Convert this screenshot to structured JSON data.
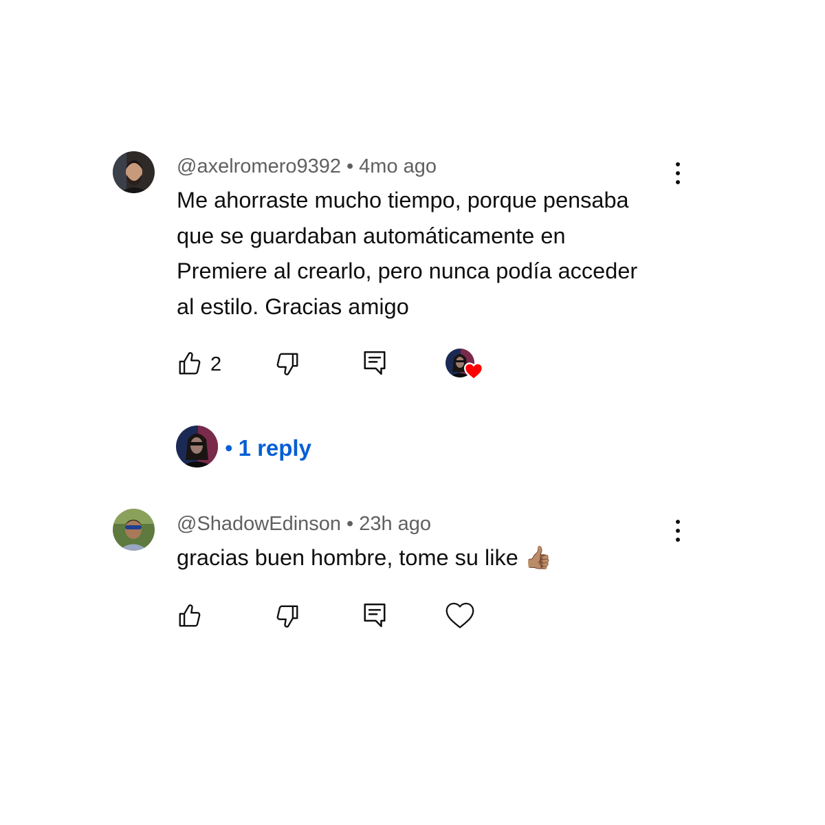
{
  "comments": [
    {
      "handle": "@axelromero9392",
      "separator": "•",
      "age": "4mo ago",
      "lines": [
        "Me ahorraste mucho tiempo, porque pensaba",
        "que se guardaban automáticamente en",
        "Premiere al crearlo, pero nunca podía acceder",
        "al estilo. Gracias amigo"
      ],
      "like_count": "2",
      "hearted": true,
      "replies": {
        "separator": "•",
        "label": "1 reply"
      }
    },
    {
      "handle": "@ShadowEdinson",
      "separator": "•",
      "age": "23h ago",
      "text": "gracias buen hombre, tome su like",
      "emoji": "👍🏽",
      "like_count": "",
      "hearted": false
    }
  ],
  "icons": {
    "like": "thumbs-up-icon",
    "dislike": "thumbs-down-icon",
    "reply": "comment-icon",
    "heart": "heart-icon",
    "more": "more-vert-icon"
  },
  "colors": {
    "link": "#065fd4",
    "heart": "#ff0000",
    "meta_text": "#606060",
    "text": "#0f0f0f"
  }
}
